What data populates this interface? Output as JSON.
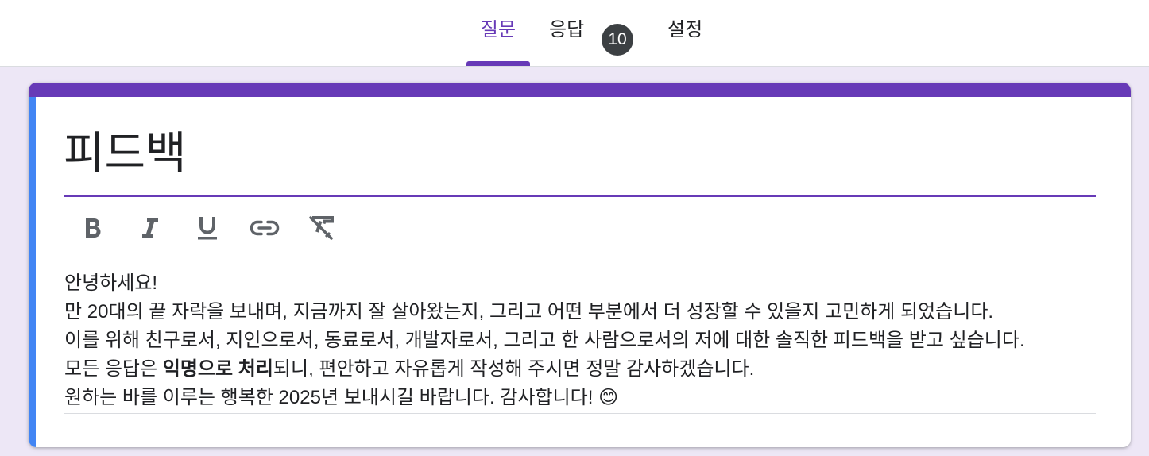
{
  "tabs": {
    "questions_label": "질문",
    "responses_label": "응답",
    "responses_count": "10",
    "settings_label": "설정"
  },
  "colors": {
    "accent": "#673ab7",
    "left_bar": "#4285f4",
    "background": "#ede7f6"
  },
  "form": {
    "title": "피드백",
    "toolbar": [
      "bold-icon",
      "italic-icon",
      "underline-icon",
      "link-icon",
      "clear-format-icon"
    ],
    "description": {
      "line1": "안녕하세요!",
      "line2": "만 20대의 끝 자락을 보내며, 지금까지 잘 살아왔는지, 그리고 어떤 부분에서 더 성장할 수 있을지 고민하게 되었습니다.",
      "line3": "이를 위해 친구로서, 지인으로서, 동료로서, 개발자로서, 그리고 한 사람으로서의 저에 대한 솔직한 피드백을 받고 싶습니다.",
      "line4_pre": "모든 응답은 ",
      "line4_bold": "익명으로 처리",
      "line4_post": "되니, 편안하고 자유롭게 작성해 주시면 정말 감사하겠습니다.",
      "line5": "원하는 바를 이루는 행복한 2025년 보내시길 바랍니다. 감사합니다! 😊"
    }
  }
}
